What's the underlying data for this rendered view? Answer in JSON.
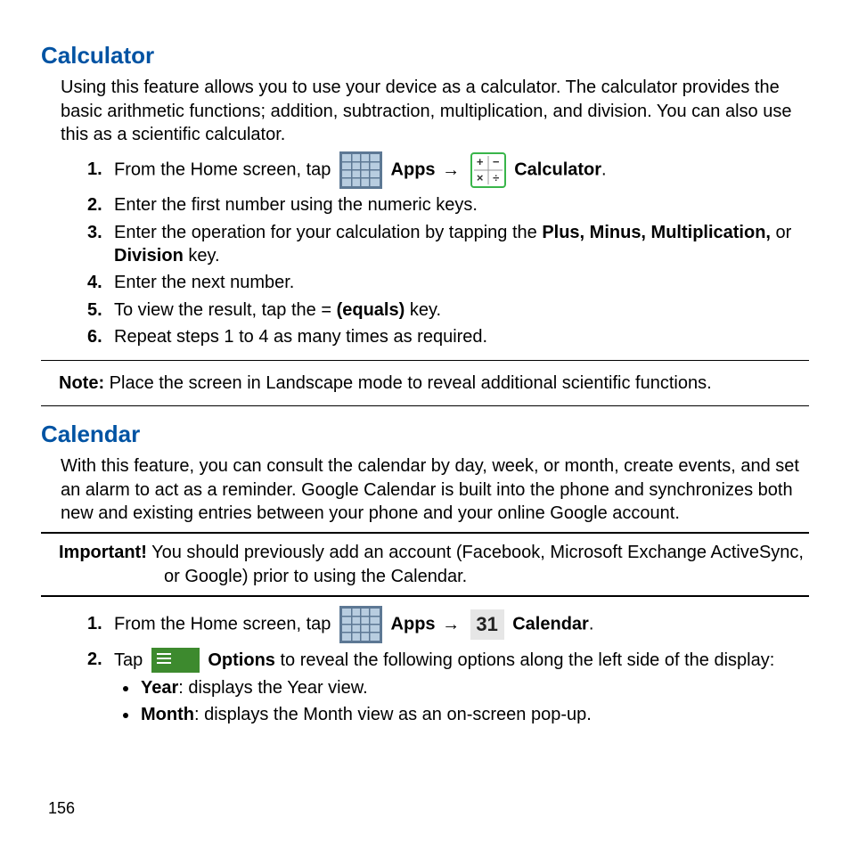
{
  "calculator": {
    "heading": "Calculator",
    "intro": "Using this feature allows you to use your device as a calculator. The calculator provides the basic arithmetic functions; addition, subtraction, multiplication, and division. You can also use this as a scientific calculator.",
    "steps": {
      "n1": "1.",
      "s1_a": "From the Home screen, tap ",
      "s1_apps": "Apps",
      "s1_arrow": " → ",
      "s1_calc": "Calculator",
      "s1_end": ".",
      "n2": "2.",
      "s2": "Enter the first number using the numeric keys.",
      "n3": "3.",
      "s3_a": "Enter the operation for your calculation by tapping the ",
      "s3_b": "Plus, Minus, Multiplication,",
      "s3_c": " or ",
      "s3_d": "Division",
      "s3_e": " key.",
      "n4": "4.",
      "s4": "Enter the next number.",
      "n5": "5.",
      "s5_a": "To view the result, tap the = ",
      "s5_b": "(equals)",
      "s5_c": " key.",
      "n6": "6.",
      "s6": "Repeat steps 1 to 4 as many times as required."
    },
    "note_label": "Note:",
    "note_text": " Place the screen in Landscape mode to reveal additional scientific functions."
  },
  "calendar": {
    "heading": "Calendar",
    "intro": "With this feature, you can consult the calendar by day, week, or month, create events, and set an alarm to act as a reminder. Google Calendar is built into the phone and synchronizes both new and existing entries between your phone and your online Google account.",
    "imp_label": "Important!",
    "imp_text": " You should previously add an account (Facebook, Microsoft Exchange ActiveSync, or Google) prior to using the Calendar.",
    "steps": {
      "n1": "1.",
      "s1_a": "From the Home screen, tap ",
      "s1_apps": "Apps",
      "s1_arrow": " → ",
      "s1_cal": "Calendar",
      "s1_end": ".",
      "cal31": "31",
      "n2": "2.",
      "s2_a": "Tap ",
      "s2_b": "Options",
      "s2_c": " to reveal the following options along the left side of the display:"
    },
    "bullets": {
      "b1_a": "Year",
      "b1_b": ": displays the Year view.",
      "b2_a": "Month",
      "b2_b": ": displays the Month view as an on-screen pop-up."
    }
  },
  "page_number": "156"
}
